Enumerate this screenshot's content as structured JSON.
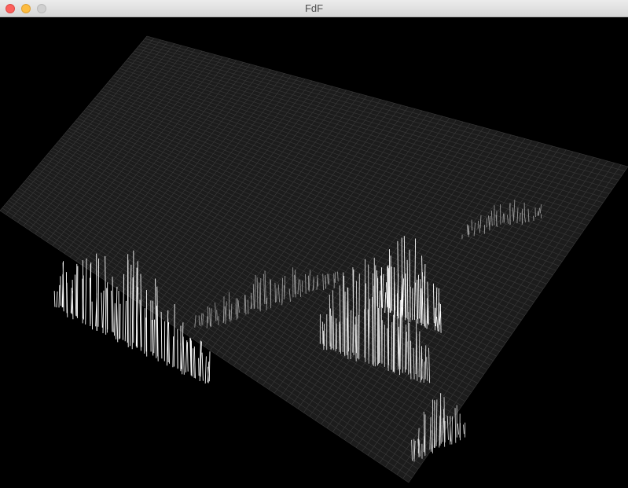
{
  "window": {
    "title": "FdF",
    "buttons": {
      "close": "close-button",
      "minimize": "minimize-button",
      "zoom": "zoom-button"
    }
  },
  "render": {
    "background_color": "#000000",
    "wire_color_low": "#3a3a3a",
    "wire_color_high": "#ffffff",
    "projection": "isometric"
  }
}
